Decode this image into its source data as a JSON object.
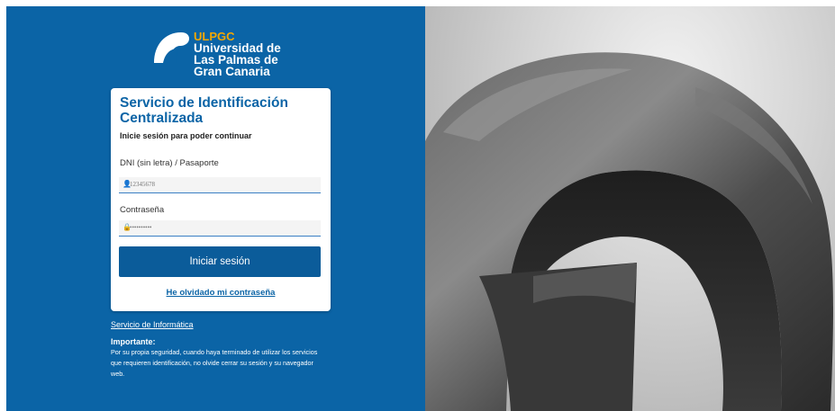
{
  "brand": {
    "abbr": "ULPGC",
    "name_lines": [
      "Universidad de",
      "Las Palmas de",
      "Gran Canaria"
    ]
  },
  "login": {
    "title": "Servicio de Identificación Centralizada",
    "subtitle": "Inicie sesión para poder continuar",
    "username": {
      "label": "DNI (sin letra) / Pasaporte",
      "placeholder": "12345678",
      "icon": "user-id-icon"
    },
    "password": {
      "label": "Contraseña",
      "placeholder": "••••••••••",
      "icon": "lock-icon"
    },
    "submit_label": "Iniciar sesión",
    "forgot_label": "He olvidado mi contraseña"
  },
  "footer": {
    "service_link": "Servicio de Informática",
    "important_title": "Importante:",
    "important_text": "Por su propia seguridad, cuando haya terminado de utilizar los servicios que requieren identificación, no olvide cerrar su sesión y su navegador web."
  },
  "colors": {
    "panel_blue": "#0b64a6",
    "button_blue": "#0b5c9a",
    "brand_gold": "#f5a800"
  }
}
